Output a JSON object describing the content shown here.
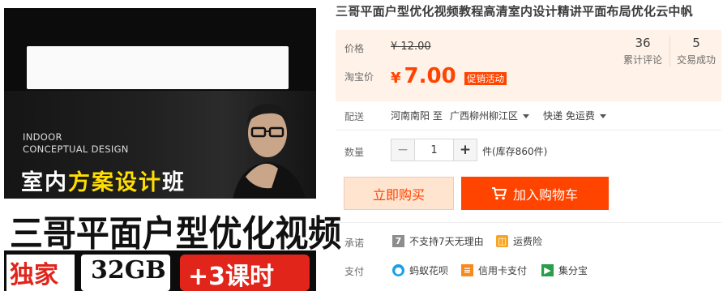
{
  "product_image": {
    "en_line1": "INDOOR",
    "en_line2": "CONCEPTUAL DESIGN",
    "course_prefix": "室内",
    "course_highlight": "方案设计",
    "course_suffix": "班",
    "headline": "三哥平面户型优化视频",
    "badge_left": "独家",
    "badge_mid": "32GB",
    "badge_right": "+3课时"
  },
  "title": "三哥平面户型优化视频教程高清室内设计精讲平面布局优化云中帆",
  "price": {
    "label": "价格",
    "original": "¥ 12.00",
    "taobao_label": "淘宝价",
    "currency": "¥",
    "current": "7.00",
    "promo": "促销活动"
  },
  "stats": {
    "reviews_count": "36",
    "reviews_label": "累计评论",
    "sales_count": "5",
    "sales_label": "交易成功"
  },
  "shipping": {
    "label": "配送",
    "from": "河南南阳 至",
    "to": "广西柳州柳江区",
    "method": "快递 免运费"
  },
  "quantity": {
    "label": "数量",
    "minus": "−",
    "value": "1",
    "plus": "+",
    "stock": "件(库存860件)"
  },
  "actions": {
    "buy_now": "立即购买",
    "add_cart": "加入购物车"
  },
  "promises": {
    "label": "承诺",
    "item1": "不支持7天无理由",
    "item2": "运费险"
  },
  "payment": {
    "label": "支付",
    "item1": "蚂蚁花呗",
    "item2": "信用卡支付",
    "item3": "集分宝"
  },
  "colors": {
    "accent": "#ff4400",
    "price_bg": "#fff2e8"
  }
}
